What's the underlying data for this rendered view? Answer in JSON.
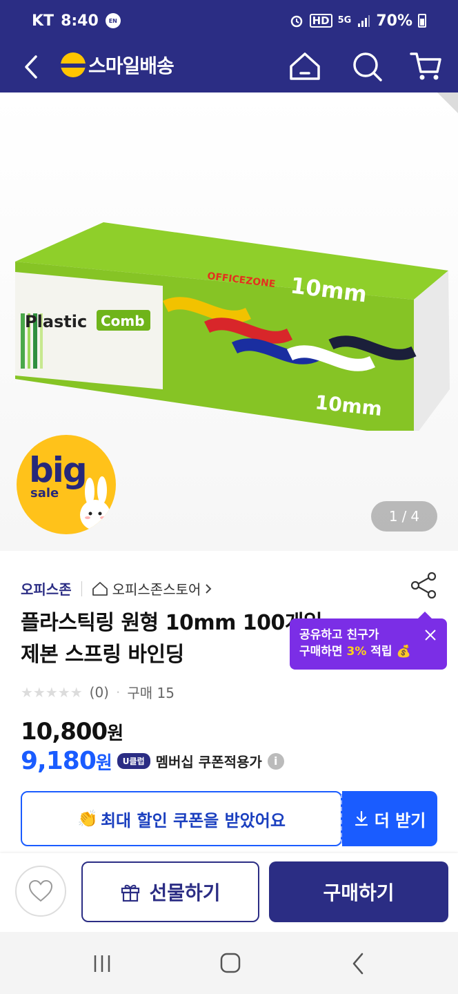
{
  "status": {
    "carrier": "KT",
    "time": "8:40",
    "en_badge": "EN",
    "hd": "HD",
    "net": "5G",
    "battery": "70%"
  },
  "header": {
    "logo_text": "스마일배송"
  },
  "hero": {
    "box_brand": "OFFICEZONE",
    "box_title_1": "Plastic",
    "box_title_2": "Comb",
    "box_size": "10mm",
    "badge_big": "big",
    "badge_sale": "sale",
    "page_current": "1",
    "page_sep": "/",
    "page_total": "4"
  },
  "product": {
    "brand": "오피스존",
    "store": "오피스존스토어",
    "title_line1": "플라스틱링 원형 10mm 100개입",
    "title_line2": "제본 스프링 바인딩",
    "rating_count": "(0)",
    "purchase_label": "구매 15",
    "price_original": "10,800",
    "price_sale": "9,180",
    "currency": "원",
    "club_badge": "U클럽",
    "membership_text": "멤버십 쿠폰적용가"
  },
  "tooltip": {
    "line1": "공유하고 친구가",
    "line2_pre": "구매하면 ",
    "line2_pct": "3%",
    "line2_post": " 적립"
  },
  "coupon": {
    "text": "최대 할인 쿠폰을 받았어요",
    "more_label": "더 받기"
  },
  "buybar": {
    "gift_label": "선물하기",
    "buy_label": "구매하기"
  },
  "colors": {
    "brand_navy": "#2b2d84",
    "accent_blue": "#1a5cff",
    "tooltip_purple": "#7b2ee6",
    "logo_yellow": "#ffc500"
  }
}
